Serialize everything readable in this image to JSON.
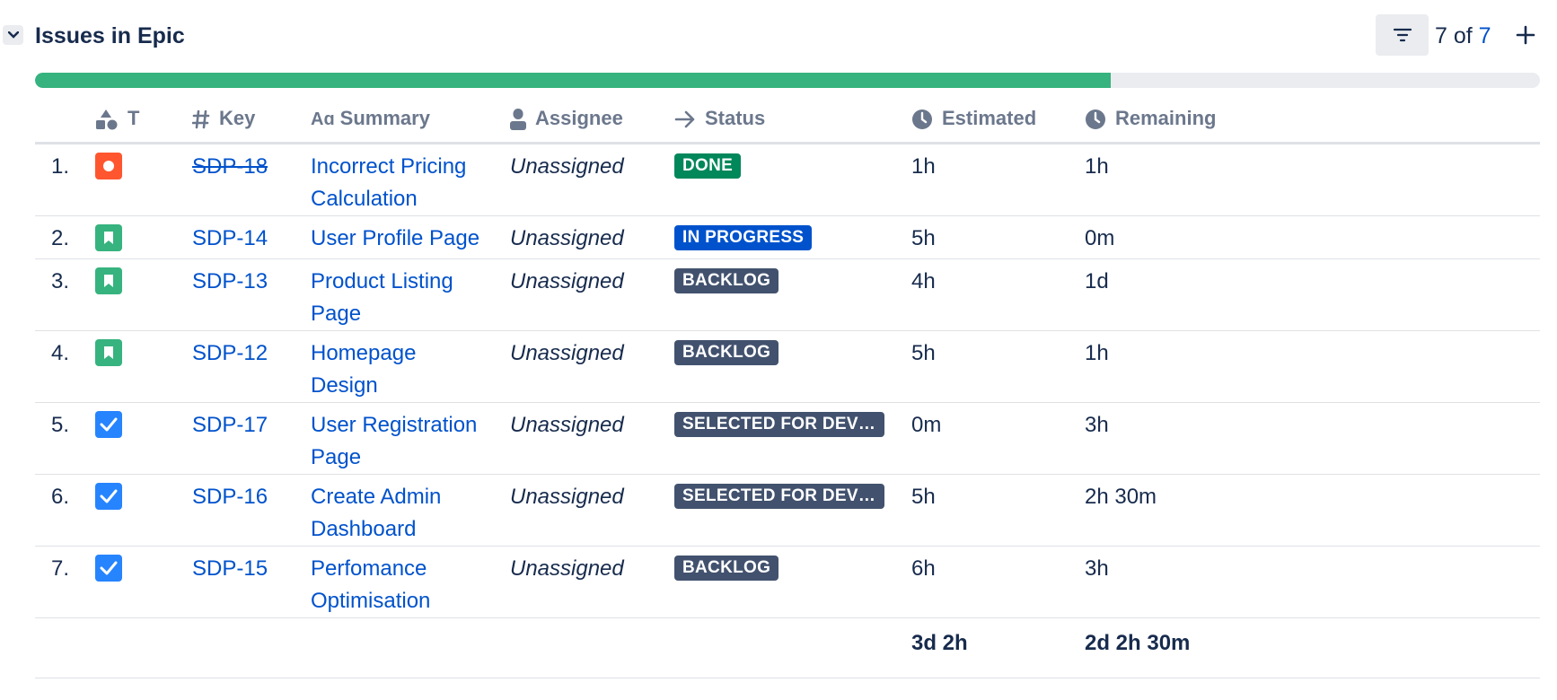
{
  "header": {
    "title": "Issues in Epic",
    "count_shown": "7 of",
    "count_total": "7"
  },
  "progress": {
    "done_fraction": 0.715,
    "fill_color": "#36b37e"
  },
  "columns": [
    {
      "label": "T",
      "icon": "issue-type-icon"
    },
    {
      "label": "Key",
      "icon": "hash-icon"
    },
    {
      "label": "Summary",
      "icon": "text-icon"
    },
    {
      "label": "Assignee",
      "icon": "person-icon"
    },
    {
      "label": "Status",
      "icon": "arrow-right-icon"
    },
    {
      "label": "Estimated",
      "icon": "clock-icon"
    },
    {
      "label": "Remaining",
      "icon": "clock-icon"
    }
  ],
  "rows": [
    {
      "num": "1.",
      "type": "bug",
      "key": "SDP-18",
      "summary": "Incorrect Pricing Calculation",
      "assignee": "Unassigned",
      "status": "DONE",
      "estimated": "1h",
      "remaining": "1h"
    },
    {
      "num": "2.",
      "type": "story",
      "key": "SDP-14",
      "summary": "User Profile Page",
      "assignee": "Unassigned",
      "status": "IN PROGRESS",
      "estimated": "5h",
      "remaining": "0m"
    },
    {
      "num": "3.",
      "type": "story",
      "key": "SDP-13",
      "summary": "Product Listing Page",
      "assignee": "Unassigned",
      "status": "BACKLOG",
      "estimated": "4h",
      "remaining": "1d"
    },
    {
      "num": "4.",
      "type": "story",
      "key": "SDP-12",
      "summary": "Homepage Design",
      "assignee": "Unassigned",
      "status": "BACKLOG",
      "estimated": "5h",
      "remaining": "1h"
    },
    {
      "num": "5.",
      "type": "task",
      "key": "SDP-17",
      "summary": "User Registration Page",
      "assignee": "Unassigned",
      "status": "SELECTED FOR DEVE...",
      "estimated": "0m",
      "remaining": "3h"
    },
    {
      "num": "6.",
      "type": "task",
      "key": "SDP-16",
      "summary": "Create Admin Dashboard",
      "assignee": "Unassigned",
      "status": "SELECTED FOR DEVE...",
      "estimated": "5h",
      "remaining": "2h 30m"
    },
    {
      "num": "7.",
      "type": "task",
      "key": "SDP-15",
      "summary": "Perfomance Optimisation",
      "assignee": "Unassigned",
      "status": "BACKLOG",
      "estimated": "6h",
      "remaining": "3h"
    }
  ],
  "totals": {
    "estimated": "3d 2h",
    "remaining": "2d 2h 30m"
  },
  "colors": {
    "bug": "#ff5630",
    "story": "#36b37e",
    "task": "#2684ff",
    "done": "#00875a",
    "in_progress": "#0052cc",
    "backlog": "#42526e",
    "link": "#0052cc"
  }
}
